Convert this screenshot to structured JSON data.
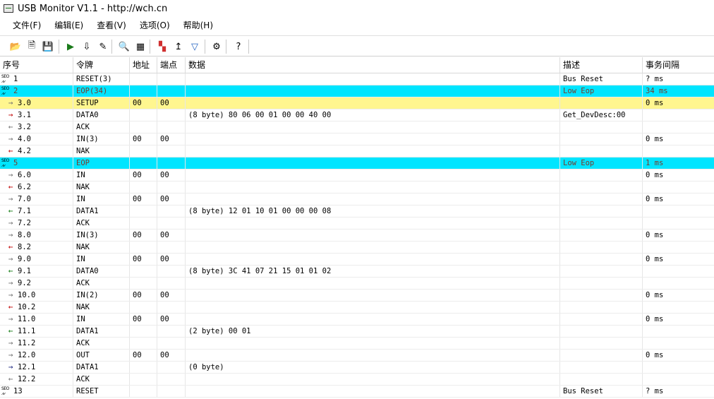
{
  "window": {
    "title": "USB Monitor V1.1 - http://wch.cn"
  },
  "menu": [
    "文件(F)",
    "编辑(E)",
    "查看(V)",
    "选项(O)",
    "帮助(H)"
  ],
  "toolbar": [
    {
      "name": "open-folder-icon",
      "glyph": "📂"
    },
    {
      "name": "open-file-icon",
      "glyph": "🗎"
    },
    {
      "name": "save-icon",
      "glyph": "💾"
    },
    {
      "name": "start-capture-icon",
      "glyph": "▶"
    },
    {
      "name": "export-icon",
      "glyph": "⇩"
    },
    {
      "name": "edit-list-icon",
      "glyph": "✎"
    },
    {
      "name": "find-icon",
      "glyph": "🔍"
    },
    {
      "name": "table-view-icon",
      "glyph": "▦"
    },
    {
      "name": "color-grid-icon",
      "glyph": "▚"
    },
    {
      "name": "trigger-icon",
      "glyph": "↥"
    },
    {
      "name": "filter-icon",
      "glyph": "▽"
    },
    {
      "name": "settings-icon",
      "glyph": "⚙"
    },
    {
      "name": "help-icon",
      "glyph": "?"
    }
  ],
  "columns": [
    "序号",
    "令牌",
    "地址",
    "端点",
    "数据",
    "描述",
    "事务间隔"
  ],
  "packets": [
    {
      "seq": "1",
      "icon": "seo",
      "token": "RESET(3)",
      "addr": "",
      "ep": "",
      "data": "",
      "desc": "Bus Reset",
      "interval": "? ms",
      "hl": ""
    },
    {
      "seq": "2",
      "icon": "seo",
      "token": "EOP(34)",
      "addr": "",
      "ep": "",
      "data": "",
      "desc": "Low Eop",
      "interval": "34 ms",
      "hl": "cyan"
    },
    {
      "seq": "3.0",
      "icon": "→",
      "icolor": "#707070",
      "token": "SETUP",
      "addr": "00",
      "ep": "00",
      "data": "",
      "desc": "",
      "interval": "0 ms",
      "hl": "yellow"
    },
    {
      "seq": "3.1",
      "icon": "→",
      "icolor": "#c00000",
      "token": "DATA0",
      "addr": "",
      "ep": "",
      "data": "(8 byte) 80 06 00 01 00 00 40 00",
      "desc": "Get_DevDesc:00",
      "interval": "",
      "hl": ""
    },
    {
      "seq": "3.2",
      "icon": "←",
      "icolor": "#707070",
      "token": "ACK",
      "addr": "",
      "ep": "",
      "data": "",
      "desc": "",
      "interval": "",
      "hl": ""
    },
    {
      "seq": "4.0",
      "icon": "→",
      "icolor": "#707070",
      "token": "IN(3)",
      "addr": "00",
      "ep": "00",
      "data": "",
      "desc": "",
      "interval": "0 ms",
      "hl": ""
    },
    {
      "seq": "4.2",
      "icon": "←",
      "icolor": "#c00000",
      "token": "NAK",
      "addr": "",
      "ep": "",
      "data": "",
      "desc": "",
      "interval": "",
      "hl": ""
    },
    {
      "seq": "5",
      "icon": "seo",
      "token": "EOP",
      "addr": "",
      "ep": "",
      "data": "",
      "desc": "Low Eop",
      "interval": "1 ms",
      "hl": "cyan"
    },
    {
      "seq": "6.0",
      "icon": "→",
      "icolor": "#707070",
      "token": "IN",
      "addr": "00",
      "ep": "00",
      "data": "",
      "desc": "",
      "interval": "0 ms",
      "hl": ""
    },
    {
      "seq": "6.2",
      "icon": "←",
      "icolor": "#c00000",
      "token": "NAK",
      "addr": "",
      "ep": "",
      "data": "",
      "desc": "",
      "interval": "",
      "hl": ""
    },
    {
      "seq": "7.0",
      "icon": "→",
      "icolor": "#707070",
      "token": "IN",
      "addr": "00",
      "ep": "00",
      "data": "",
      "desc": "",
      "interval": "0 ms",
      "hl": ""
    },
    {
      "seq": "7.1",
      "icon": "←",
      "icolor": "#107a10",
      "token": "DATA1",
      "addr": "",
      "ep": "",
      "data": "(8 byte) 12 01 10 01 00 00 00 08",
      "desc": "",
      "interval": "",
      "hl": ""
    },
    {
      "seq": "7.2",
      "icon": "→",
      "icolor": "#707070",
      "token": "ACK",
      "addr": "",
      "ep": "",
      "data": "",
      "desc": "",
      "interval": "",
      "hl": ""
    },
    {
      "seq": "8.0",
      "icon": "→",
      "icolor": "#707070",
      "token": "IN(3)",
      "addr": "00",
      "ep": "00",
      "data": "",
      "desc": "",
      "interval": "0 ms",
      "hl": ""
    },
    {
      "seq": "8.2",
      "icon": "←",
      "icolor": "#c00000",
      "token": "NAK",
      "addr": "",
      "ep": "",
      "data": "",
      "desc": "",
      "interval": "",
      "hl": ""
    },
    {
      "seq": "9.0",
      "icon": "→",
      "icolor": "#707070",
      "token": "IN",
      "addr": "00",
      "ep": "00",
      "data": "",
      "desc": "",
      "interval": "0 ms",
      "hl": ""
    },
    {
      "seq": "9.1",
      "icon": "←",
      "icolor": "#107a10",
      "token": "DATA0",
      "addr": "",
      "ep": "",
      "data": "(8 byte) 3C 41 07 21 15 01 01 02",
      "desc": "",
      "interval": "",
      "hl": ""
    },
    {
      "seq": "9.2",
      "icon": "→",
      "icolor": "#707070",
      "token": "ACK",
      "addr": "",
      "ep": "",
      "data": "",
      "desc": "",
      "interval": "",
      "hl": ""
    },
    {
      "seq": "10.0",
      "icon": "→",
      "icolor": "#707070",
      "token": "IN(2)",
      "addr": "00",
      "ep": "00",
      "data": "",
      "desc": "",
      "interval": "0 ms",
      "hl": ""
    },
    {
      "seq": "10.2",
      "icon": "←",
      "icolor": "#c00000",
      "token": "NAK",
      "addr": "",
      "ep": "",
      "data": "",
      "desc": "",
      "interval": "",
      "hl": ""
    },
    {
      "seq": "11.0",
      "icon": "→",
      "icolor": "#707070",
      "token": "IN",
      "addr": "00",
      "ep": "00",
      "data": "",
      "desc": "",
      "interval": "0 ms",
      "hl": ""
    },
    {
      "seq": "11.1",
      "icon": "←",
      "icolor": "#107a10",
      "token": "DATA1",
      "addr": "",
      "ep": "",
      "data": "(2 byte) 00 01",
      "desc": "",
      "interval": "",
      "hl": ""
    },
    {
      "seq": "11.2",
      "icon": "→",
      "icolor": "#707070",
      "token": "ACK",
      "addr": "",
      "ep": "",
      "data": "",
      "desc": "",
      "interval": "",
      "hl": ""
    },
    {
      "seq": "12.0",
      "icon": "→",
      "icolor": "#707070",
      "token": "OUT",
      "addr": "00",
      "ep": "00",
      "data": "",
      "desc": "",
      "interval": "0 ms",
      "hl": ""
    },
    {
      "seq": "12.1",
      "icon": "→",
      "icolor": "#1a237e",
      "token": "DATA1",
      "addr": "",
      "ep": "",
      "data": "(0 byte)",
      "desc": "",
      "interval": "",
      "hl": ""
    },
    {
      "seq": "12.2",
      "icon": "←",
      "icolor": "#707070",
      "token": "ACK",
      "addr": "",
      "ep": "",
      "data": "",
      "desc": "",
      "interval": "",
      "hl": ""
    },
    {
      "seq": "13",
      "icon": "seo",
      "token": "RESET",
      "addr": "",
      "ep": "",
      "data": "",
      "desc": "Bus Reset",
      "interval": "? ms",
      "hl": ""
    }
  ]
}
